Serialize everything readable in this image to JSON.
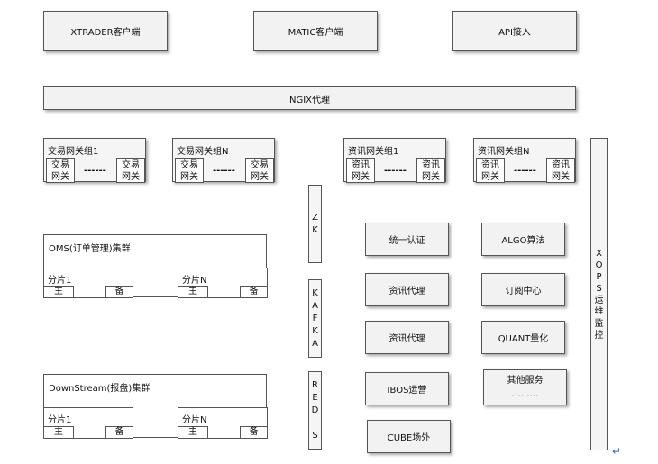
{
  "clients": [
    "XTRADER客户端",
    "MATIC客户端",
    "API接入"
  ],
  "proxy": "NGIX代理",
  "gateway_groups": [
    {
      "title": "交易网关组1",
      "left": "交易\n网关",
      "dots": "------",
      "right": "交易\n网关"
    },
    {
      "title": "交易网关组N",
      "left": "交易\n网关",
      "dots": "------",
      "right": "交易\n网关"
    },
    {
      "title": "资讯网关组1",
      "left": "资讯\n网关",
      "dots": "------",
      "right": "资讯\n网关"
    },
    {
      "title": "资讯网关组N",
      "left": "资讯\n网关",
      "dots": "------",
      "right": "资讯\n网关"
    }
  ],
  "clusters": [
    {
      "title": "OMS(订单管理)集群",
      "shards": [
        {
          "title": "分片1",
          "primary": "主",
          "backup": "备"
        },
        {
          "title": "分片N",
          "primary": "主",
          "backup": "备"
        }
      ]
    },
    {
      "title": "DownStream(报盘)集群",
      "shards": [
        {
          "title": "分片1",
          "primary": "主",
          "backup": "备"
        },
        {
          "title": "分片N",
          "primary": "主",
          "backup": "备"
        }
      ]
    }
  ],
  "middleware": [
    {
      "name": "ZK",
      "chars": [
        "Z",
        "K"
      ]
    },
    {
      "name": "KAFKA",
      "chars": [
        "K",
        "A",
        "F",
        "K",
        "A"
      ]
    },
    {
      "name": "REDIS",
      "chars": [
        "R",
        "E",
        "D",
        "I",
        "S"
      ]
    }
  ],
  "services_left": [
    "统一认证",
    "资讯代理",
    "资讯代理",
    "IBOS运营",
    "CUBE场外"
  ],
  "services_right": [
    "ALGO算法",
    "订阅中心",
    "QUANT量化",
    "其他服务",
    "………"
  ],
  "monitor": {
    "name": "XOPS运维监控",
    "chars": [
      "X",
      "O",
      "P",
      "S",
      "运",
      "维",
      "监",
      "控"
    ]
  },
  "return_mark": "↵"
}
